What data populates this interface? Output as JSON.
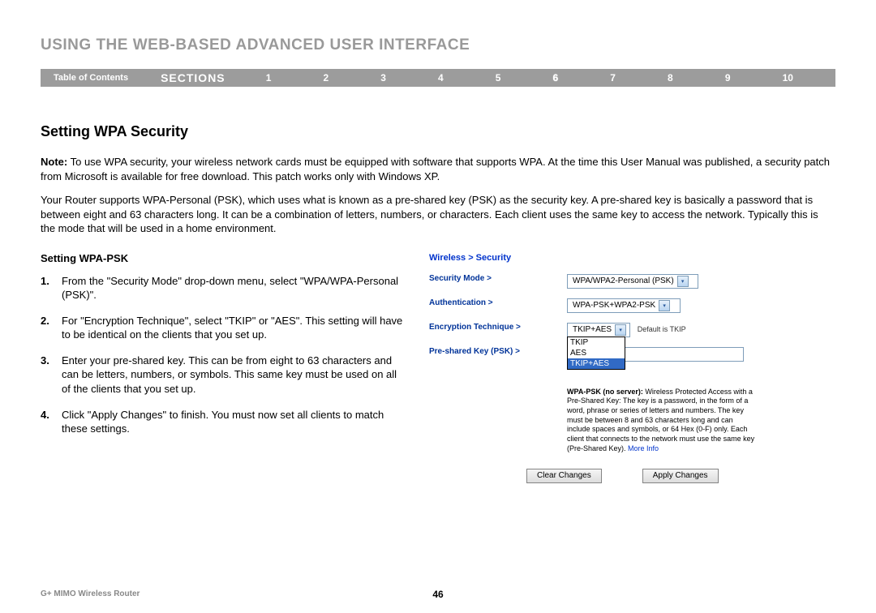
{
  "header": {
    "title": "USING THE WEB-BASED ADVANCED USER INTERFACE"
  },
  "nav": {
    "toc": "Table of Contents",
    "sections_label": "SECTIONS",
    "items": [
      "1",
      "2",
      "3",
      "4",
      "5",
      "6",
      "7",
      "8",
      "9",
      "10"
    ],
    "active": "6"
  },
  "section": {
    "title": "Setting WPA Security",
    "note_label": "Note:",
    "note_body": " To use WPA security, your wireless network cards must be equipped with software that supports WPA. At the time this User Manual was published, a security patch from Microsoft is available for free download. This patch works only with Windows XP.",
    "para": "Your Router supports WPA-Personal (PSK), which uses what is known as a pre-shared key (PSK) as the security key. A pre-shared key is basically a password that is between eight and 63 characters long. It can be a combination of letters, numbers, or characters. Each client uses the same key to access the network. Typically this is the mode that will be used in a home environment."
  },
  "left": {
    "subtitle": "Setting WPA-PSK",
    "steps": [
      {
        "num": "1.",
        "text": "From the \"Security Mode\" drop-down menu, select \"WPA/WPA-Personal (PSK)\"."
      },
      {
        "num": "2.",
        "text": "For \"Encryption Technique\", select \"TKIP\" or \"AES\". This setting will have to be identical on the clients that you set up."
      },
      {
        "num": "3.",
        "text": "Enter your pre-shared key. This can be from eight to 63 characters and can be letters, numbers, or symbols. This same key must be used on all of the clients that you set up."
      },
      {
        "num": "4.",
        "text": "Click \"Apply Changes\" to finish. You must now set all clients to match these settings."
      }
    ]
  },
  "ui": {
    "breadcrumb": "Wireless > Security",
    "rows": {
      "security_mode": {
        "label": "Security Mode >",
        "value": "WPA/WPA2-Personal (PSK)"
      },
      "authentication": {
        "label": "Authentication >",
        "value": "WPA-PSK+WPA2-PSK"
      },
      "encryption": {
        "label": "Encryption Technique >",
        "value": "TKIP+AES",
        "default_text": "Default is TKIP"
      },
      "psk": {
        "label": "Pre-shared Key (PSK) >",
        "value": ""
      }
    },
    "dropdown_options": [
      "TKIP",
      "AES",
      "TKIP+AES"
    ],
    "dropdown_selected": "TKIP+AES",
    "help": {
      "lead": "WPA-PSK (no server):",
      "body": " Wireless Protected Access with a Pre-Shared Key: The key is a password, in the form of a word, phrase or series of letters and numbers. The key must be between 8 and 63 characters long and can include spaces and symbols, or 64 Hex (0-F) only. Each client that connects to the network must use the same key (Pre-Shared Key). ",
      "more": "More Info"
    },
    "buttons": {
      "clear": "Clear Changes",
      "apply": "Apply Changes"
    }
  },
  "footer": {
    "product": "G+ MIMO Wireless Router",
    "page": "46"
  }
}
